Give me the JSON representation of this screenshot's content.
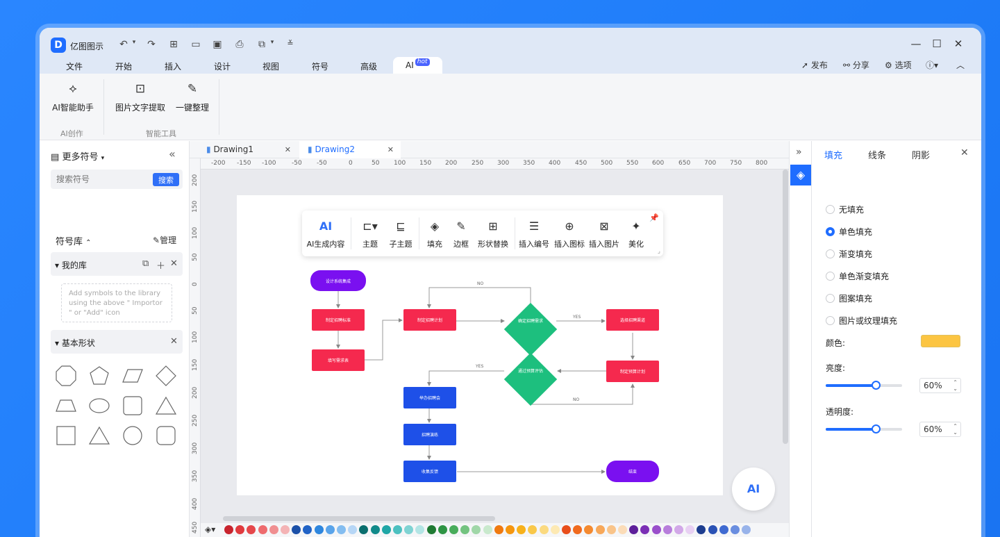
{
  "app": {
    "name": "亿图图示",
    "logo": "D"
  },
  "quick_access": [
    "undo-icon",
    "redo-icon",
    "new-icon",
    "open-icon",
    "save-icon",
    "print-icon",
    "export-icon",
    "customize-icon"
  ],
  "window_controls": [
    "minimize-icon",
    "maximize-icon",
    "close-icon"
  ],
  "menu": [
    {
      "label": "文件"
    },
    {
      "label": "开始"
    },
    {
      "label": "插入"
    },
    {
      "label": "设计"
    },
    {
      "label": "视图"
    },
    {
      "label": "符号"
    },
    {
      "label": "高级"
    },
    {
      "label": "AI",
      "badge": "hot",
      "active": true
    }
  ],
  "right_menu": {
    "publish": "发布",
    "share": "分享",
    "options": "选项"
  },
  "ribbon": {
    "buttons": [
      {
        "label": "AI智能助手",
        "icon": "ai-assistant-icon"
      },
      {
        "label": "图片文字提取",
        "icon": "ocr-icon"
      },
      {
        "label": "一键整理",
        "icon": "organize-icon"
      }
    ],
    "groups": [
      {
        "label": "AI创作"
      },
      {
        "label": "智能工具"
      }
    ]
  },
  "left_panel": {
    "title": "更多符号",
    "search_placeholder": "搜索符号",
    "search_button": "搜索",
    "library_title": "符号库",
    "manage": "管理",
    "my_library": "我的库",
    "empty_hint": "Add symbols to the library using the above \" Importor \" or \"Add\" icon",
    "basic_shapes": "基本形状"
  },
  "tabs": [
    {
      "label": "Drawing1"
    },
    {
      "label": "Drawing2",
      "active": true
    }
  ],
  "ruler": {
    "h": [
      "-200",
      "-150",
      "-100",
      "-50",
      "-50",
      "0",
      "50",
      "100",
      "150",
      "200",
      "250",
      "300",
      "350",
      "400",
      "450",
      "500",
      "550",
      "600",
      "650",
      "700",
      "750",
      "800"
    ],
    "v": [
      "200",
      "150",
      "100",
      "50",
      "0",
      "50",
      "100",
      "150",
      "200",
      "250",
      "300",
      "350",
      "400",
      "450"
    ]
  },
  "float_toolbar": [
    {
      "label": "AI生成内容",
      "icon": "ai-text-icon"
    },
    {
      "label": "主题",
      "icon": "theme-icon"
    },
    {
      "label": "子主题",
      "icon": "subtopic-icon"
    },
    {
      "label": "填充",
      "icon": "fill-icon"
    },
    {
      "label": "边框",
      "icon": "border-icon"
    },
    {
      "label": "形状替换",
      "icon": "shape-replace-icon"
    },
    {
      "label": "插入编号",
      "icon": "numbering-icon"
    },
    {
      "label": "插入图标",
      "icon": "insert-icon-icon"
    },
    {
      "label": "插入图片",
      "icon": "insert-image-icon"
    },
    {
      "label": "美化",
      "icon": "beautify-icon"
    }
  ],
  "flowchart": {
    "nodes": [
      {
        "text": "设计系统集成"
      },
      {
        "text": "制定招聘标准"
      },
      {
        "text": "填写需求表"
      },
      {
        "text": "制定招聘计划"
      },
      {
        "text": "确定招聘需求"
      },
      {
        "text": "选择招聘渠道"
      },
      {
        "text": "通过预算评估"
      },
      {
        "text": "制定预算计划"
      },
      {
        "text": "举办招聘会"
      },
      {
        "text": "招聘演练"
      },
      {
        "text": "收集反馈"
      },
      {
        "text": "结束"
      }
    ],
    "edge_labels": [
      "NO",
      "YES",
      "YES",
      "NO"
    ]
  },
  "ai_bubble": "AI",
  "palette": [
    "#c8242e",
    "#e03a3e",
    "#e5474b",
    "#ee6b6e",
    "#f08f91",
    "#f4b3b5",
    "#1b50a8",
    "#2163c6",
    "#2e86de",
    "#5aa4ea",
    "#84bdf0",
    "#b6d6f6",
    "#0a6e6e",
    "#118a8a",
    "#1fa6a6",
    "#4cc0c0",
    "#7fd3d3",
    "#b3e5e5",
    "#1f7a33",
    "#2e9444",
    "#48ac5b",
    "#73c380",
    "#a0d7a8",
    "#c9e9cd",
    "#f07a10",
    "#f5960f",
    "#f7b11b",
    "#f9c84a",
    "#fbda80",
    "#fde9b3",
    "#e84e1b",
    "#f06a1e",
    "#f48a30",
    "#f7a85a",
    "#f9c48a",
    "#fbdcb8",
    "#5d1f9a",
    "#7b2fb5",
    "#9a4fcb",
    "#b77ddb",
    "#d2a8e8",
    "#e8d0f3",
    "#1d3d8f",
    "#2a52b5",
    "#3f6ad1",
    "#6a8ee0",
    "#98b3ea"
  ],
  "right_panel": {
    "tabs": [
      {
        "label": "填充",
        "active": true
      },
      {
        "label": "线条"
      },
      {
        "label": "阴影"
      }
    ],
    "fill_options": [
      {
        "label": "无填充"
      },
      {
        "label": "单色填充",
        "selected": true
      },
      {
        "label": "渐变填充"
      },
      {
        "label": "单色渐变填充"
      },
      {
        "label": "图案填充"
      },
      {
        "label": "图片或纹理填充"
      }
    ],
    "color_label": "颜色:",
    "color_value": "#fcc542",
    "brightness_label": "亮度:",
    "brightness_value": "60%",
    "brightness_fraction": 0.6,
    "opacity_label": "透明度:",
    "opacity_value": "60%",
    "opacity_fraction": 0.6
  },
  "colors": {
    "accent": "#1f6dff",
    "node_red": "#f5294e",
    "node_blue": "#1e50e8",
    "node_purple": "#7a10f0",
    "node_green": "#1dbf7e"
  }
}
